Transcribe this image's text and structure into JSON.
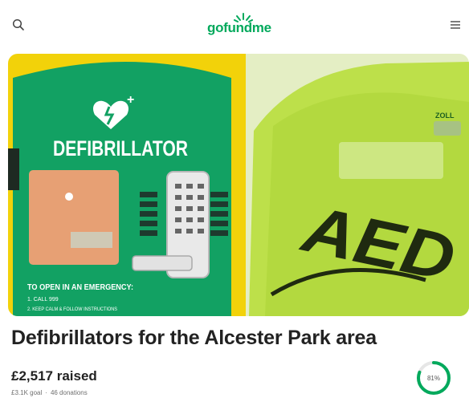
{
  "header": {
    "logo_text": "gofundme",
    "icons": {
      "search": "search-icon",
      "menu": "hamburger-menu-icon"
    }
  },
  "hero": {
    "sign_title": "DEFIBRILLATOR",
    "sign_instructions_heading": "TO OPEN IN AN EMERGENCY:",
    "sign_step_1": "1. CALL 999",
    "sign_step_2": "2. KEEP CALM & FOLLOW INSTRUCTIONS",
    "device_label": "AED",
    "device_brand": "ZOLL",
    "colors": {
      "cabinet_green": "#12a163",
      "cabinet_yellow": "#f2d20a",
      "aed_green": "#bde04a"
    }
  },
  "campaign": {
    "title": "Defibrillators for the Alcester Park area",
    "raised": "£2,517 raised",
    "goal": "£3.1K goal",
    "donations": "46 donations",
    "progress_label": "81%",
    "progress_fraction": 0.81
  },
  "colors": {
    "brand": "#02a95c",
    "progress_track": "#e6e6e6"
  }
}
